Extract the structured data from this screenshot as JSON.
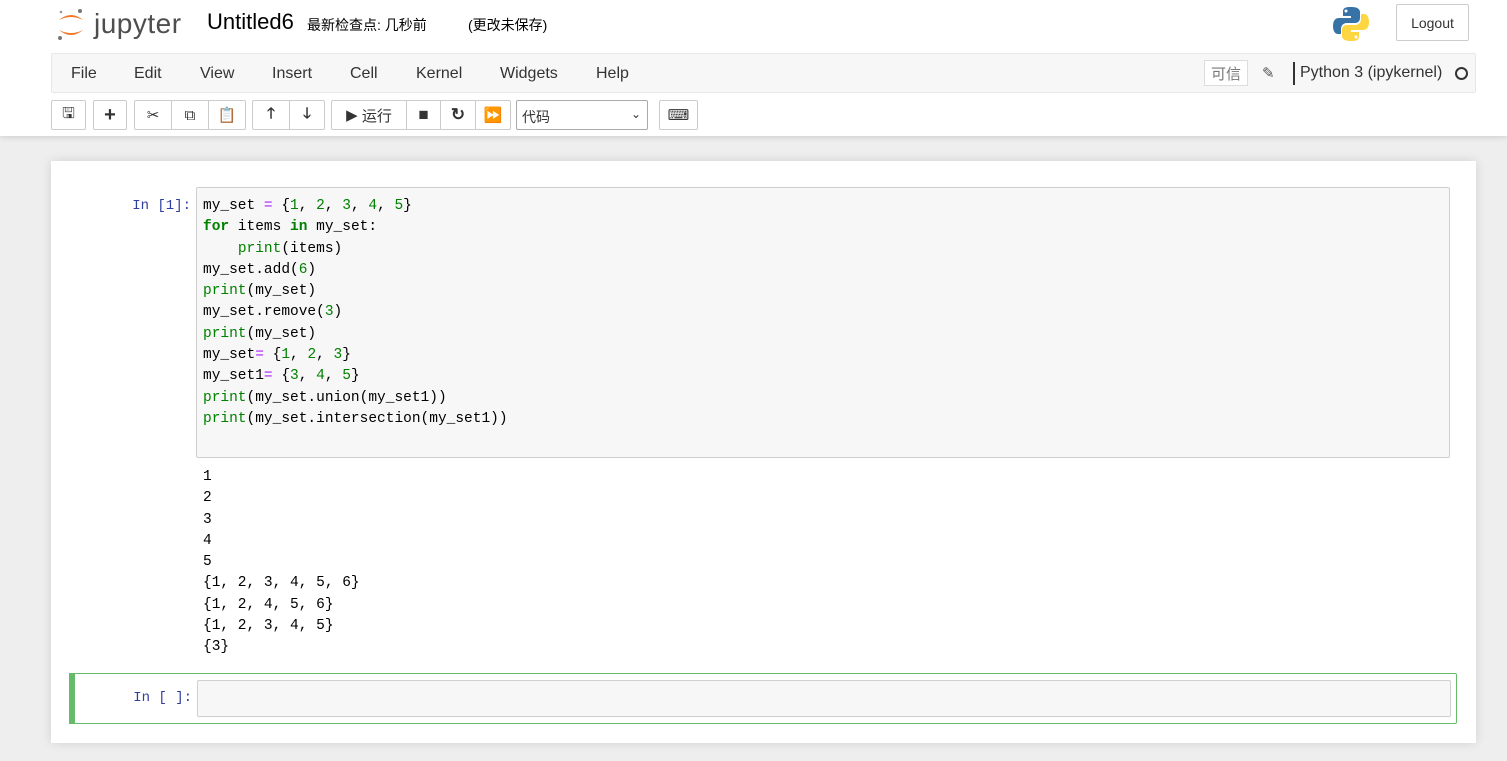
{
  "header": {
    "logo_text": "jupyter",
    "notebook_title": "Untitled6",
    "checkpoint": "最新检查点: 几秒前",
    "unsaved": "(更改未保存)",
    "logout": "Logout"
  },
  "menu": {
    "items": [
      "File",
      "Edit",
      "View",
      "Insert",
      "Cell",
      "Kernel",
      "Widgets",
      "Help"
    ],
    "trusted": "可信",
    "kernel_name": "Python 3 (ipykernel)"
  },
  "toolbar": {
    "run_label": "运行",
    "cell_type": "代码"
  },
  "cells": [
    {
      "prompt": "In  [1]:",
      "code": [
        [
          [
            "my_set ",
            "n"
          ],
          [
            "=",
            "o"
          ],
          [
            " {",
            "n"
          ],
          [
            "1",
            "m"
          ],
          [
            ", ",
            "n"
          ],
          [
            "2",
            "m"
          ],
          [
            ", ",
            "n"
          ],
          [
            "3",
            "m"
          ],
          [
            ", ",
            "n"
          ],
          [
            "4",
            "m"
          ],
          [
            ", ",
            "n"
          ],
          [
            "5",
            "m"
          ],
          [
            "}",
            "n"
          ]
        ],
        [
          [
            "for",
            "k"
          ],
          [
            " items ",
            "n"
          ],
          [
            "in",
            "k"
          ],
          [
            " my_set:",
            "n"
          ]
        ],
        [
          [
            "    ",
            "n"
          ],
          [
            "print",
            "b"
          ],
          [
            "(items)",
            "n"
          ]
        ],
        [
          [
            "my_set.add(",
            "n"
          ],
          [
            "6",
            "m"
          ],
          [
            ")",
            "n"
          ]
        ],
        [
          [
            "print",
            "b"
          ],
          [
            "(my_set)",
            "n"
          ]
        ],
        [
          [
            "my_set.remove(",
            "n"
          ],
          [
            "3",
            "m"
          ],
          [
            ")",
            "n"
          ]
        ],
        [
          [
            "print",
            "b"
          ],
          [
            "(my_set)",
            "n"
          ]
        ],
        [
          [
            "my_set",
            "n"
          ],
          [
            "=",
            "o"
          ],
          [
            " {",
            "n"
          ],
          [
            "1",
            "m"
          ],
          [
            ", ",
            "n"
          ],
          [
            "2",
            "m"
          ],
          [
            ", ",
            "n"
          ],
          [
            "3",
            "m"
          ],
          [
            "}",
            "n"
          ]
        ],
        [
          [
            "my_set1",
            "n"
          ],
          [
            "=",
            "o"
          ],
          [
            " {",
            "n"
          ],
          [
            "3",
            "m"
          ],
          [
            ", ",
            "n"
          ],
          [
            "4",
            "m"
          ],
          [
            ", ",
            "n"
          ],
          [
            "5",
            "m"
          ],
          [
            "}",
            "n"
          ]
        ],
        [
          [
            "print",
            "b"
          ],
          [
            "(my_set.union(my_set1))",
            "n"
          ]
        ],
        [
          [
            "print",
            "b"
          ],
          [
            "(my_set.intersection(my_set1))",
            "n"
          ]
        ]
      ],
      "output": [
        "1",
        "2",
        "3",
        "4",
        "5",
        "{1, 2, 3, 4, 5, 6}",
        "{1, 2, 4, 5, 6}",
        "{1, 2, 3, 4, 5}",
        "{3}"
      ]
    },
    {
      "prompt": "In  [ ]:"
    }
  ]
}
